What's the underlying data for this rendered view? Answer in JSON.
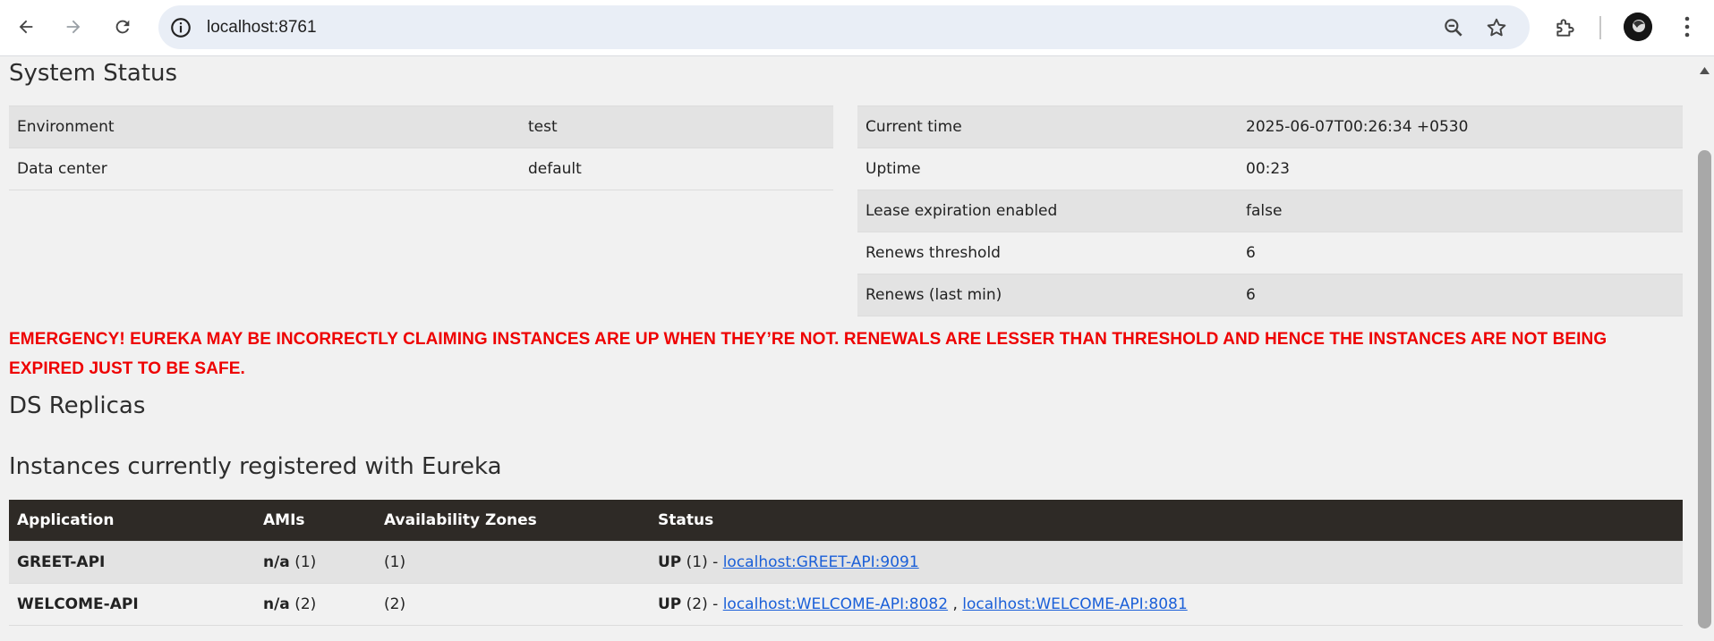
{
  "browser": {
    "url": "localhost:8761",
    "icons": [
      "back-arrow-icon",
      "forward-arrow-icon",
      "reload-icon",
      "site-info-icon",
      "zoom-icon",
      "bookmark-star-icon",
      "extensions-icon",
      "profile-avatar",
      "kebab-menu-icon"
    ]
  },
  "system_status": {
    "title": "System Status",
    "left": [
      {
        "label": "Environment",
        "value": "test"
      },
      {
        "label": "Data center",
        "value": "default"
      }
    ],
    "right": [
      {
        "label": "Current time",
        "value": "2025-06-07T00:26:34 +0530"
      },
      {
        "label": "Uptime",
        "value": "00:23"
      },
      {
        "label": "Lease expiration enabled",
        "value": "false"
      },
      {
        "label": "Renews threshold",
        "value": "6"
      },
      {
        "label": "Renews (last min)",
        "value": "6"
      }
    ]
  },
  "emergency": "EMERGENCY! EUREKA MAY BE INCORRECTLY CLAIMING INSTANCES ARE UP WHEN THEY’RE NOT. RENEWALS ARE LESSER THAN THRESHOLD AND HENCE THE INSTANCES ARE NOT BEING EXPIRED JUST TO BE SAFE.",
  "ds_replicas": {
    "title": "DS Replicas"
  },
  "instances": {
    "title": "Instances currently registered with Eureka",
    "headers": [
      "Application",
      "AMIs",
      "Availability Zones",
      "Status"
    ],
    "rows": [
      {
        "application": "GREET-API",
        "ami_bold": "n/a",
        "ami_count": "(1)",
        "zones": "(1)",
        "status_bold": "UP",
        "status_count": "(1) -",
        "links": [
          "localhost:GREET-API:9091"
        ],
        "separator": ""
      },
      {
        "application": "WELCOME-API",
        "ami_bold": "n/a",
        "ami_count": "(2)",
        "zones": "(2)",
        "status_bold": "UP",
        "status_count": "(2) -",
        "links": [
          "localhost:WELCOME-API:8082",
          "localhost:WELCOME-API:8081"
        ],
        "separator": ","
      }
    ]
  },
  "colors": {
    "emergency_text": "#ee0000",
    "table_header_bg": "#2e2a26",
    "link": "#1a5fd8",
    "page_bg": "#f1f1f1"
  }
}
